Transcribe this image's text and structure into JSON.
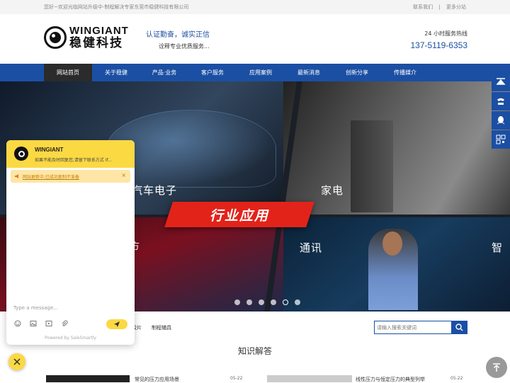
{
  "topbar": {
    "welcome": "您好~欢迎光临网站升级中-制程解决专家东莞市稳健科技有限公司",
    "contact": "联系我们",
    "sep": "|",
    "branches": "更多分站"
  },
  "header": {
    "logo_en": "WINGIANT",
    "logo_cn": "稳健科技",
    "slogan1": "认证勤奋，诚实正信",
    "slogan2": "诠释专业优质服务...",
    "hotline_label": "24 小时服务热线",
    "hotline": "137-5119-6353"
  },
  "nav": {
    "items": [
      "网站首页",
      "关于稳健",
      "产品·业务",
      "客户服务",
      "应用案例",
      "最新消息",
      "创新分享",
      "传播媒介"
    ]
  },
  "banner": {
    "labels": [
      "汽车电子",
      "家电",
      "通讯",
      "智"
    ],
    "left_partial": "方",
    "headline": "行业应用",
    "slide_count": 6,
    "active_slide": 5
  },
  "categories": [
    "胶片",
    "制程辅具"
  ],
  "search": {
    "placeholder": "请输入搜索关键词"
  },
  "section": {
    "title": "知识解答"
  },
  "articles": [
    {
      "title": "常见的压力应用场景",
      "date": "05-22"
    },
    {
      "title": "线性压力与恒定压力的典型列举",
      "date": "05-22"
    }
  ],
  "chat": {
    "name": "WINGIANT",
    "subtitle": "如果不能及时回复您,请留下联系方式 If...",
    "notice": "网站更新中,已成功复制不准备",
    "notice_close": "×",
    "input_placeholder": "Type a message...",
    "powered": "Powered by SaleSmartly"
  },
  "colors": {
    "brand_blue": "#1b4fa3",
    "chat_yellow": "#fbd943",
    "accent_red": "#e2231a"
  }
}
